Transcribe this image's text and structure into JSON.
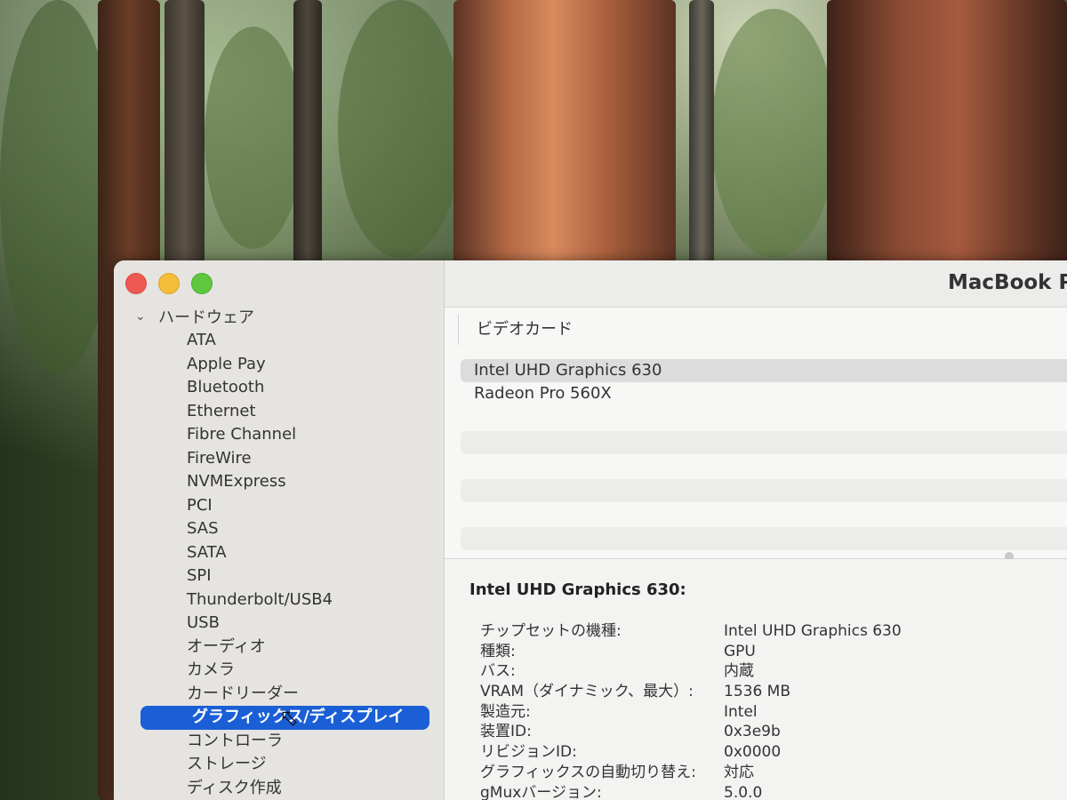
{
  "window": {
    "title": "MacBook P"
  },
  "sidebar": {
    "root_label": "ハードウェア",
    "items": [
      {
        "label": "ATA"
      },
      {
        "label": "Apple Pay"
      },
      {
        "label": "Bluetooth"
      },
      {
        "label": "Ethernet"
      },
      {
        "label": "Fibre Channel"
      },
      {
        "label": "FireWire"
      },
      {
        "label": "NVMExpress"
      },
      {
        "label": "PCI"
      },
      {
        "label": "SAS"
      },
      {
        "label": "SATA"
      },
      {
        "label": "SPI"
      },
      {
        "label": "Thunderbolt/USB4"
      },
      {
        "label": "USB"
      },
      {
        "label": "オーディオ"
      },
      {
        "label": "カメラ"
      },
      {
        "label": "カードリーダー"
      },
      {
        "label": "グラフィックス/ディスプレイ",
        "selected": true
      },
      {
        "label": "コントローラ"
      },
      {
        "label": "ストレージ"
      },
      {
        "label": "ディスク作成"
      }
    ]
  },
  "table": {
    "column_header": "ビデオカード",
    "rows": [
      {
        "label": "Intel UHD Graphics 630",
        "selected": true
      },
      {
        "label": "Radeon Pro 560X"
      }
    ]
  },
  "detail": {
    "title": "Intel UHD Graphics 630:",
    "properties": [
      {
        "key": "チップセットの機種:",
        "value": "Intel UHD Graphics 630"
      },
      {
        "key": "種類:",
        "value": "GPU"
      },
      {
        "key": "バス:",
        "value": "内蔵"
      },
      {
        "key": "VRAM（ダイナミック、最大）:",
        "value": "1536 MB"
      },
      {
        "key": "製造元:",
        "value": "Intel"
      },
      {
        "key": "装置ID:",
        "value": "0x3e9b"
      },
      {
        "key": "リビジョンID:",
        "value": "0x0000"
      },
      {
        "key": "グラフィックスの自動切り替え:",
        "value": "対応"
      },
      {
        "key": "gMuxバージョン:",
        "value": "5.0.0"
      }
    ]
  },
  "colors": {
    "selection": "#1b5fd6",
    "close": "#ee5a52",
    "minimize": "#f4bd3a",
    "zoom": "#5ec73f"
  }
}
